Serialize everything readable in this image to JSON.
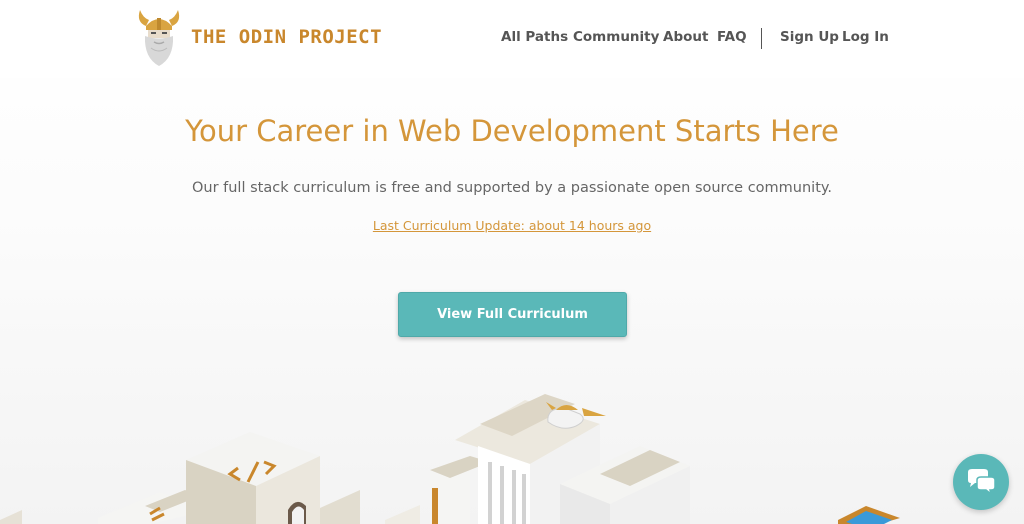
{
  "brand": {
    "name": "THE ODIN PROJECT"
  },
  "nav": {
    "all_paths": "All Paths",
    "community": "Community",
    "about": "About",
    "faq": "FAQ",
    "sign_up": "Sign Up",
    "log_in": "Log In"
  },
  "hero": {
    "title": "Your Career in Web Development Starts Here",
    "subtitle": "Our full stack curriculum is free and supported by a passionate open source community.",
    "update_link": "Last Curriculum Update: about 14 hours ago",
    "cta_label": "View Full Curriculum"
  },
  "icons": {
    "logo": "odin-viking-logo-icon",
    "code": "code-brackets-icon",
    "chat": "chat-bubbles-icon"
  },
  "colors": {
    "brand_orange": "#d4963a",
    "teal": "#5ab8b8",
    "nav_text": "#555555",
    "body_text": "#666666"
  }
}
